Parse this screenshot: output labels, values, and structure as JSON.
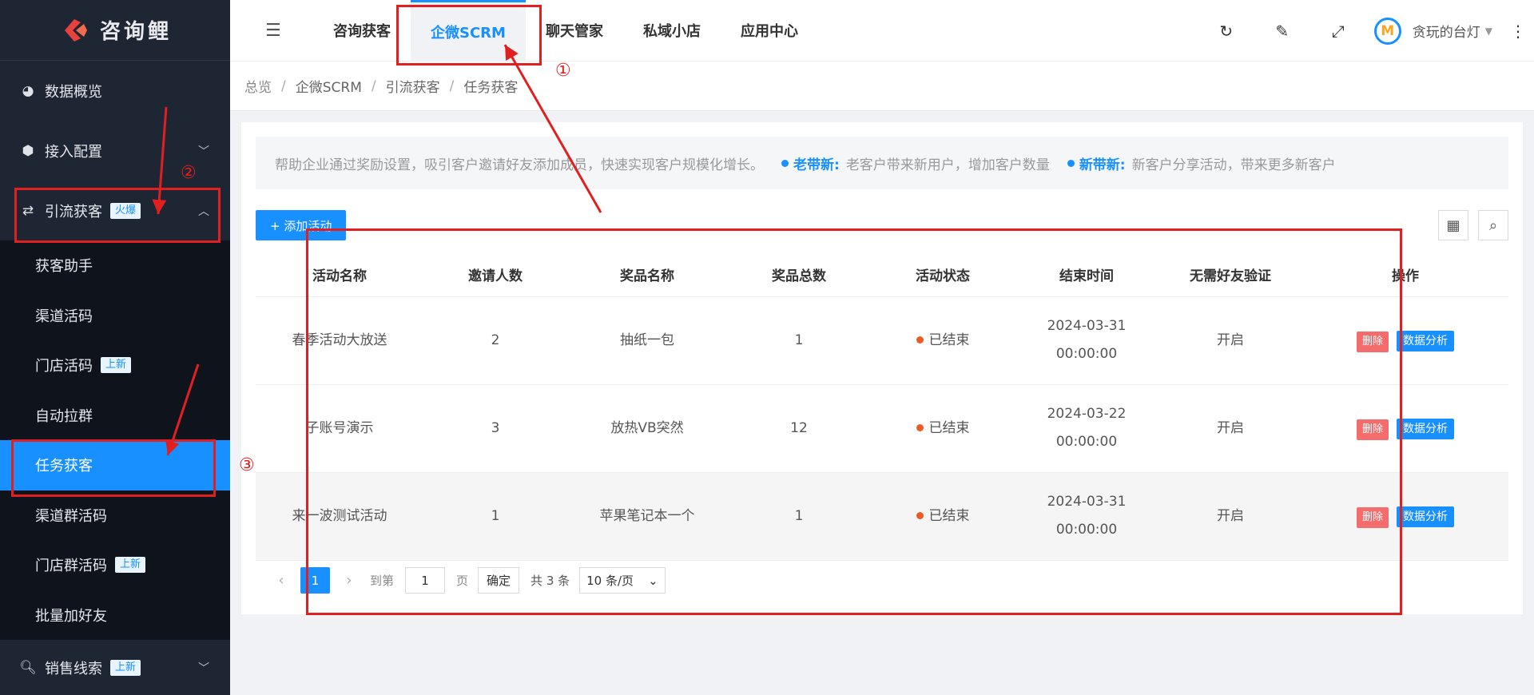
{
  "app": {
    "logo_text": "咨询鲤"
  },
  "sidebar": {
    "items": [
      {
        "label": "数据概览",
        "icon": "pie-chart-icon"
      },
      {
        "label": "接入配置",
        "icon": "box-icon"
      },
      {
        "label": "引流获客",
        "icon": "swap-icon",
        "badge": "火爆"
      }
    ],
    "submenu": [
      {
        "label": "获客助手"
      },
      {
        "label": "渠道活码"
      },
      {
        "label": "门店活码",
        "badge": "上新"
      },
      {
        "label": "自动拉群"
      },
      {
        "label": "任务获客",
        "active": true
      },
      {
        "label": "渠道群活码"
      },
      {
        "label": "门店群活码",
        "badge": "上新"
      },
      {
        "label": "批量加好友"
      }
    ],
    "bottom_item": {
      "label": "销售线索",
      "badge": "上新"
    }
  },
  "header": {
    "nav": [
      "咨询获客",
      "企微SCRM",
      "聊天管家",
      "私域小店",
      "应用中心"
    ],
    "active_nav": "企微SCRM",
    "user_name": "贪玩的台灯"
  },
  "breadcrumb": [
    "总览",
    "企微SCRM",
    "引流获客",
    "任务获客"
  ],
  "tip": {
    "text": "帮助企业通过奖励设置，吸引客户邀请好友添加成员，快速实现客户规模化增长。",
    "item1_title": "老带新:",
    "item1_text": "老客户带来新用户，增加客户数量",
    "item2_title": "新带新:",
    "item2_text": "新客户分享活动，带来更多新客户"
  },
  "toolbar": {
    "add_label": "+ 添加活动"
  },
  "table": {
    "columns": [
      "活动名称",
      "邀请人数",
      "奖品名称",
      "奖品总数",
      "活动状态",
      "结束时间",
      "无需好友验证",
      "操作"
    ],
    "rows": [
      {
        "name": "春季活动大放送",
        "invites": "2",
        "prize": "抽纸一包",
        "total": "1",
        "status": "已结束",
        "end_date": "2024-03-31",
        "end_time": "00:00:00",
        "verify": "开启"
      },
      {
        "name": "子账号演示",
        "invites": "3",
        "prize": "放热VB突然",
        "total": "12",
        "status": "已结束",
        "end_date": "2024-03-22",
        "end_time": "00:00:00",
        "verify": "开启"
      },
      {
        "name": "来一波测试活动",
        "invites": "1",
        "prize": "苹果笔记本一个",
        "total": "1",
        "status": "已结束",
        "end_date": "2024-03-31",
        "end_time": "00:00:00",
        "verify": "开启"
      }
    ],
    "op_delete": "删除",
    "op_data": "数据分析"
  },
  "pagination": {
    "current": "1",
    "goto_label": "到第",
    "goto_value": "1",
    "page_unit": "页",
    "confirm": "确定",
    "total": "共 3 条",
    "page_size": "10 条/页"
  },
  "annotations": {
    "n1": "①",
    "n2": "②",
    "n3": "③",
    "color": "#e02020"
  },
  "colors": {
    "primary": "#1890ff",
    "sidebar_bg": "#1f2633",
    "danger": "#f56c6c",
    "status_dot": "#ee5a24"
  }
}
